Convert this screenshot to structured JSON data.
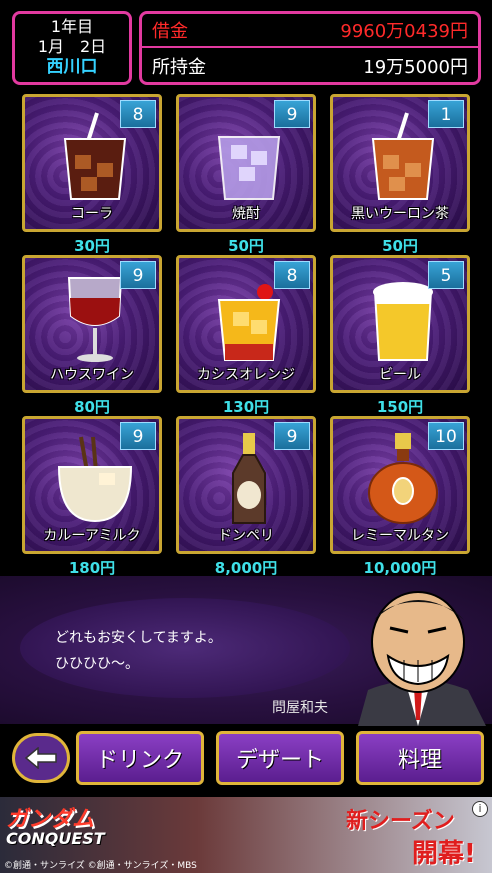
{
  "header": {
    "year": "1年目",
    "date": "1月　2日",
    "location": "西川口",
    "debt_label": "借金",
    "debt_value": "9960万0439円",
    "cash_label": "所持金",
    "cash_value": "19万5000円"
  },
  "items": [
    {
      "name": "コーラ",
      "price": "30円",
      "count": "8",
      "icon": "cola-glass-icon"
    },
    {
      "name": "焼酎",
      "price": "50円",
      "count": "9",
      "icon": "shochu-glass-icon"
    },
    {
      "name": "黒いウーロン茶",
      "price": "50円",
      "count": "1",
      "icon": "oolong-tea-glass-icon"
    },
    {
      "name": "ハウスワイン",
      "price": "80円",
      "count": "9",
      "icon": "wine-glass-icon"
    },
    {
      "name": "カシスオレンジ",
      "price": "130円",
      "count": "8",
      "icon": "cassis-orange-glass-icon"
    },
    {
      "name": "ビール",
      "price": "150円",
      "count": "5",
      "icon": "beer-glass-icon"
    },
    {
      "name": "カルーアミルク",
      "price": "180円",
      "count": "9",
      "icon": "kahlua-milk-glass-icon"
    },
    {
      "name": "ドンペリ",
      "price": "8,000円",
      "count": "9",
      "icon": "champagne-bottle-icon"
    },
    {
      "name": "レミーマルタン",
      "price": "10,000円",
      "count": "10",
      "icon": "cognac-bottle-icon"
    }
  ],
  "dialog": {
    "line1": "どれもお安くしてますよ。",
    "line2": "ひひひひ～。",
    "speaker": "問屋和夫"
  },
  "buttons": {
    "drink": "ドリンク",
    "dessert": "デザート",
    "food": "料理"
  },
  "ad": {
    "title": "ガンダム",
    "subtitle": "CONQUEST",
    "new_season": "新シーズン",
    "open": "開幕!",
    "copyright": "©創通・サンライズ ©創通・サンライズ・MBS"
  },
  "colors": {
    "frame_pink": "#e23aa0",
    "debt_red": "#ff2a2a",
    "price_cyan": "#3fe0e8",
    "card_gold": "#c9a632",
    "badge_blue": "#2a8fc0"
  }
}
